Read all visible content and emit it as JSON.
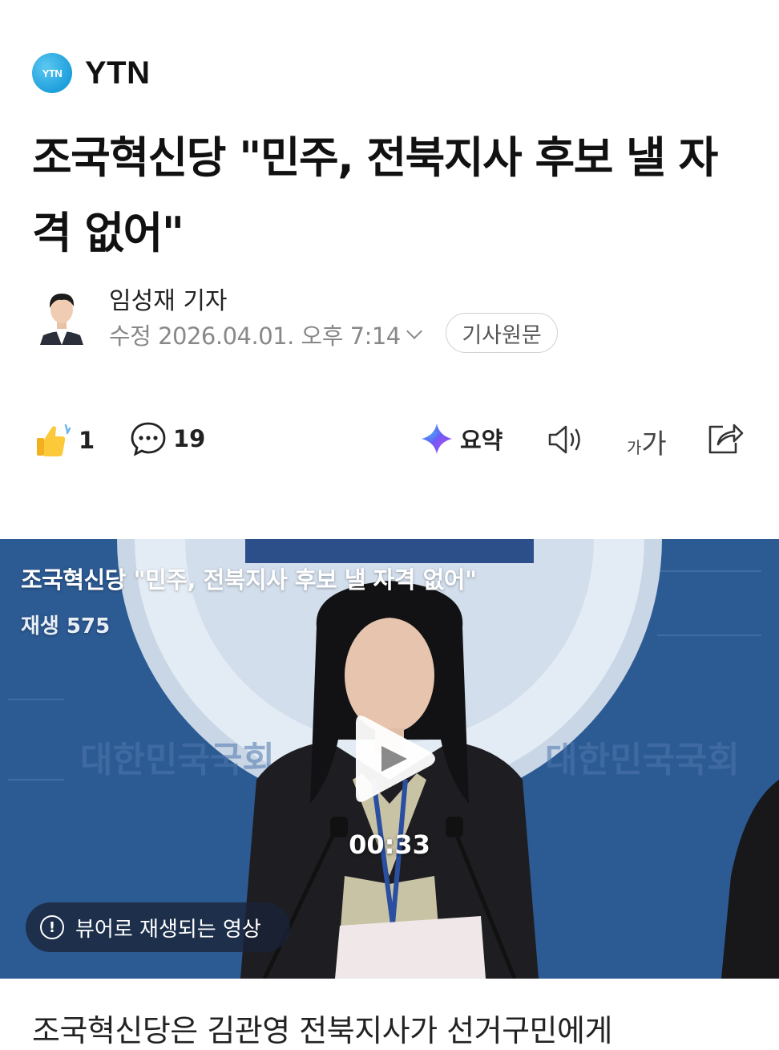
{
  "press": {
    "logo_text": "YTN",
    "name": "YTN"
  },
  "article": {
    "headline": "조국혁신당 \"민주, 전북지사 후보 낼 자격 없어\"",
    "reporter": "임성재 기자",
    "date": "수정 2026.04.01. 오후 7:14",
    "original_button": "기사원문",
    "body_first_line": "조국혁신당은 김관영 전북지사가 선거구민에게"
  },
  "actions": {
    "like_count": "1",
    "comment_count": "19",
    "summary_label": "요약",
    "font_small": "가",
    "font_large": "가"
  },
  "video": {
    "title": "조국혁신당 \"민주, 전북지사 후보 낼 자격 없어\"",
    "views": "재생 575",
    "duration": "00:33",
    "notice": "뷰어로 재생되는 영상",
    "background_text_seal": "대한민국국회",
    "background_text_left": "대한민국국회",
    "background_text_right": "대한민국국회"
  },
  "colors": {
    "logo": "#1e9fdc",
    "video_bg": "#2a5791",
    "text": "#111111",
    "muted": "#888888"
  }
}
